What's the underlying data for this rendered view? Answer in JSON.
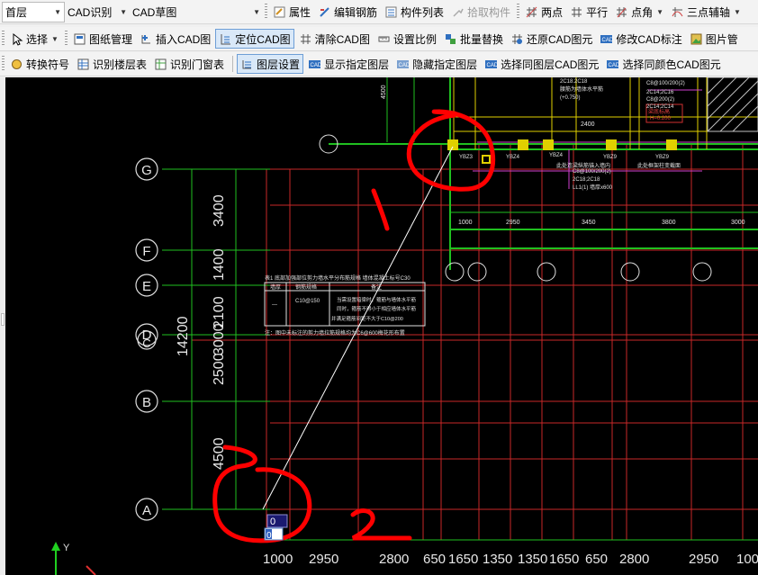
{
  "toolbar1": {
    "floor_select": "首层",
    "cad_recognize": "CAD识别",
    "cad_draft": "CAD草图",
    "buttons": [
      "属性",
      "编辑钢筋",
      "构件列表",
      "拾取构件",
      "两点",
      "平行",
      "点角",
      "三点辅轴"
    ]
  },
  "toolbar2": {
    "select_label": "选择",
    "buttons": [
      "图纸管理",
      "插入CAD图",
      "定位CAD图",
      "清除CAD图",
      "设置比例",
      "批量替换",
      "还原CAD图元",
      "修改CAD标注",
      "图片管"
    ]
  },
  "toolbar3": {
    "buttons": [
      "转换符号",
      "识别楼层表",
      "识别门窗表",
      "图层设置",
      "显示指定图层",
      "隐藏指定图层",
      "选择同图层CAD图元",
      "选择同颜色CAD图元"
    ]
  },
  "drawing": {
    "axes_letters": [
      "G",
      "F",
      "E",
      "D",
      "C",
      "B",
      "A"
    ],
    "left_dims": [
      "3400",
      "1400",
      "2100",
      "3000",
      "2500",
      "4500"
    ],
    "total_dim": "14200",
    "bottom_dims": [
      "1000",
      "2950",
      "2800",
      "650",
      "1650",
      "1350",
      "1350",
      "1650",
      "650",
      "2800",
      "2950",
      "100"
    ],
    "top_dims": [
      "1000",
      "2950",
      "3450",
      "3800",
      "3000"
    ],
    "top_small": [
      "2400",
      "4500"
    ],
    "wall_labels": [
      "YBZ3",
      "YBZ4",
      "YBZ4",
      "YBZ9",
      "YBZ9"
    ],
    "table_title": "表1 底部加强部位剪力墙水平分布筋规格 墙体混凝土标号C30",
    "table_headers": [
      "墙厚",
      "钢筋规格",
      "备注"
    ],
    "table_row": [
      "—",
      "C10@150"
    ],
    "table_notes": [
      "当需设置暗梁时，箍筋与墙体水平筋",
      "同时，箍筋不得小于相应墙体水平筋",
      "并满足箍筋间距不大于C10@200"
    ],
    "table_footer": "注：图中未标注的剪力墙拉筋规格均为C6@600梅花形布置",
    "notes": [
      "2C18.2C18",
      "腰筋为墙体水平筋",
      "(+0.750)",
      "C8@100/200(2)",
      "2C14;2C16",
      "C8@100/200(2)",
      "2C18;2C18",
      "LL1(1) 墙厚x600",
      "C8@200(2)",
      "2C14;2C14",
      "梁底标高",
      "H=0.200",
      "此处框架柱变截面",
      "此处连梁纵筋锚入墙内"
    ],
    "annotation_1": "1",
    "annotation_2": "2",
    "input_value": "0",
    "input_value2": "0",
    "axis_y_label": "Y"
  },
  "colors": {
    "grid_red": "#e03030",
    "axis_green": "#20d020",
    "wall_yellow": "#e0d000",
    "magenta": "#e040e0",
    "annotation_red": "#ff0000"
  }
}
